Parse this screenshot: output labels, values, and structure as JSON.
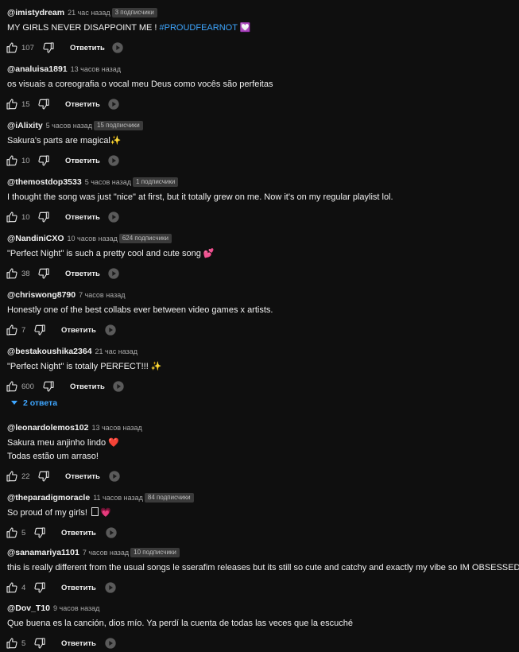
{
  "labels": {
    "reply": "Ответить"
  },
  "colors": {
    "background": "#0f0f0f",
    "text": "#f1f1f1",
    "meta": "#aaaaaa",
    "link": "#3ea6ff",
    "badge_bg": "#3a3a3a"
  },
  "icons": {
    "like": "thumb-up-icon",
    "dislike": "thumb-down-icon",
    "ai": "ai-sparkle-icon",
    "expand": "caret-down-icon",
    "heart": "heart-icon"
  },
  "comments": [
    {
      "user": "@imistydream",
      "time": "21 час назад",
      "subs": "3 подписчики",
      "text": "MY GIRLS NEVER DISAPPOINT ME ! ",
      "hashtag": "#PROUDFEARNOT",
      "emoji": "💟",
      "likes": "107"
    },
    {
      "user": "@analuisa1891",
      "time": "13 часов назад",
      "text": "os visuais a coreografia o vocal meu Deus como vocês são perfeitas",
      "likes": "15"
    },
    {
      "user": "@iAlixity",
      "time": "5 часов назад",
      "subs": "15 подписчики",
      "text": "Sakura's parts are magical",
      "emoji": "✨",
      "likes": "10"
    },
    {
      "user": "@themostdop3533",
      "time": "5 часов назад",
      "subs": "1 подписчики",
      "text": "I thought the song was just \"nice\" at first, but it totally grew on me. Now it's on my regular playlist lol.",
      "likes": "10"
    },
    {
      "user": "@NandiniCXO",
      "time": "10 часов назад",
      "subs": "624 подписчики",
      "text": "\"Perfect Night\" is such a pretty cool and cute song ",
      "emoji": "💕",
      "likes": "38"
    },
    {
      "user": "@chriswong8790",
      "time": "7 часов назад",
      "text": "Honestly one of the best collabs ever between video games x artists.",
      "likes": "7"
    },
    {
      "user": "@bestakoushika2364",
      "time": "21 час назад",
      "text": "\"Perfect Night\" is totally PERFECT!!! ",
      "emoji": "✨",
      "likes": "600"
    },
    {
      "user": "@leonardolemos102",
      "time": "13 часов назад",
      "text": "Sakura meu anjinho lindo ",
      "emoji": "❤️",
      "text2": "Todas estão um arraso!",
      "likes": "22"
    },
    {
      "user": "@theparadigmoracle",
      "time": "11 часов назад",
      "subs": "84 подписчики",
      "text": "So proud of my girls! ",
      "emoji": "💗",
      "likes": "5"
    },
    {
      "user": "@sanamariya1101",
      "time": "7 часов назад",
      "subs": "10 подписчики",
      "text": "this is really different from the usual songs le sserafim releases but its still so cute and catchy and exactly my vibe so IM OBSESSED",
      "likes": "4"
    },
    {
      "user": "@Dov_T10",
      "time": "9 часов назад",
      "text": "Que buena es la canción, dios mío. Ya perdí la cuenta de todas las veces que la escuché",
      "likes": "5"
    }
  ],
  "replies_toggle": {
    "label": "2 ответа"
  }
}
